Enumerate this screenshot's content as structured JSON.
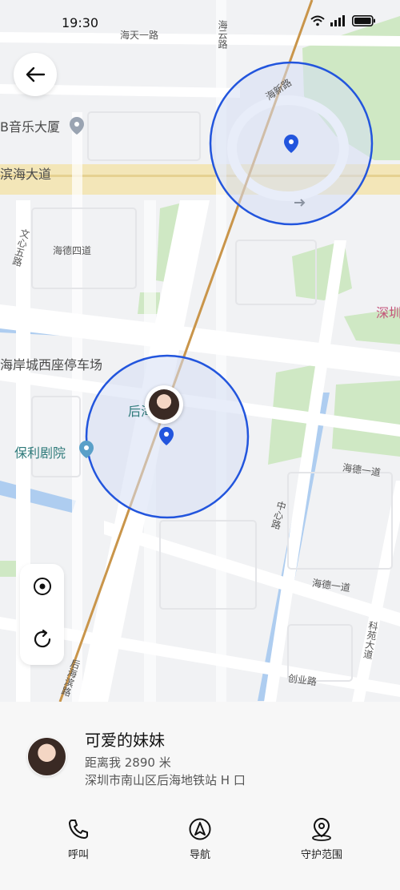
{
  "status_bar": {
    "time": "19:30"
  },
  "map": {
    "labels": {
      "haitian": "海天一路",
      "haiyun": "海云路",
      "music_building": "B音乐大厦",
      "binhai": "滨海大道",
      "haixin": "海新路",
      "wenxin": "文心五路",
      "haide4": "海德四道",
      "parking": "海岸城西座停车场",
      "houhai": "后海",
      "poly": "保利剧院",
      "haide1a": "海德一道",
      "haide1b": "海德一道",
      "zhongxin": "中心路",
      "kehuan": "科苑大道",
      "chuangye": "创业路",
      "houhaibin": "后海滨路",
      "shenzhen": "深圳"
    }
  },
  "contact": {
    "name": "可爱的妹妹",
    "distance": "距离我 2890 米",
    "address": "深圳市南山区后海地铁站 H 口"
  },
  "actions": [
    {
      "label": "呼叫",
      "icon": "phone-icon"
    },
    {
      "label": "导航",
      "icon": "navigation-icon"
    },
    {
      "label": "守护范围",
      "icon": "location-pin-icon"
    }
  ],
  "colors": {
    "accent": "#2255dd",
    "circle_fill": "#d5def4",
    "green_area": "#cfe8c4",
    "highway": "#f3e6b8",
    "rail": "#c9954a"
  }
}
